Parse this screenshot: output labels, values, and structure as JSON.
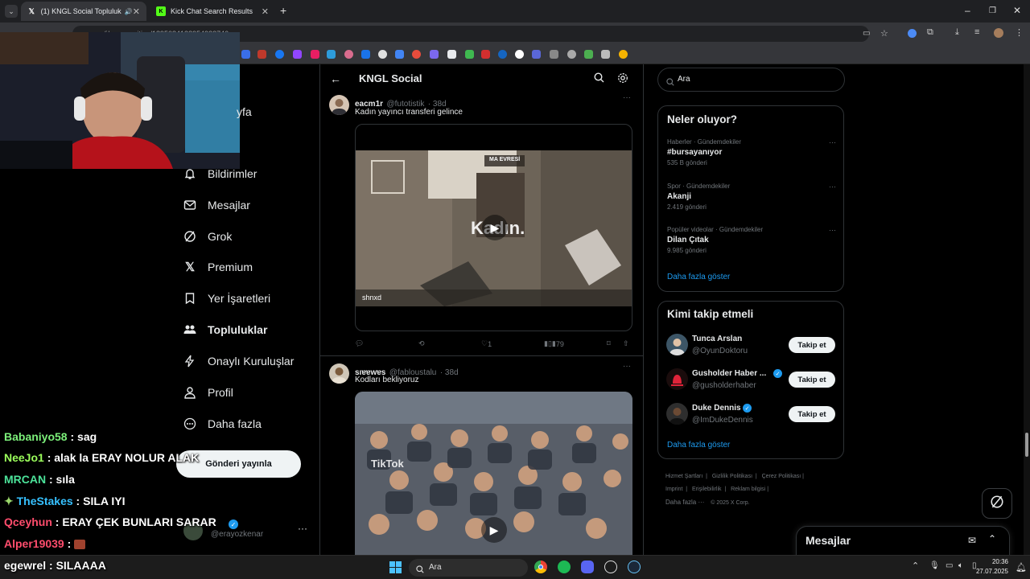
{
  "tabs": [
    {
      "label": "(1) KNGL Social Topluluk / X"
    },
    {
      "label": "Kick Chat Search Results"
    }
  ],
  "address": {
    "url": "x.com/i/communities/1895084139549337...",
    "visible_fragment": "x.com/i/communities/1895084138954933746"
  },
  "nav": {
    "items": [
      {
        "label": "Anasayfa"
      },
      {
        "label": "Bildirimler"
      },
      {
        "label": "Mesajlar"
      },
      {
        "label": "Grok"
      },
      {
        "label": "Premium"
      },
      {
        "label": "Yer İşaretleri"
      },
      {
        "label": "Topluluklar"
      },
      {
        "label": "Onaylı Kuruluşlar"
      },
      {
        "label": "Profil"
      },
      {
        "label": "Daha fazla"
      }
    ],
    "partial_home": "yfa",
    "post_button": "Gönderi yayınla",
    "account_handle": "@erayozkenar"
  },
  "chat": [
    {
      "user": "Babaniyo58",
      "msg": " : sag",
      "color": "#7cf07a"
    },
    {
      "user": "NeeJo1",
      "msg": " : alak la ERAY NOLUR ALAK",
      "color": "#9cff5c"
    },
    {
      "user": "MRCAN",
      "msg": " : sıla",
      "color": "#4ce39a"
    },
    {
      "user": "TheStakes",
      "msg": " : SILA IYI",
      "color": "#36c1ff"
    },
    {
      "user": "Qceyhun",
      "msg": " : ERAY ÇEK BUNLARI SARAR",
      "color": "#ff4d6d"
    },
    {
      "user": "Alper19039",
      "msg": " : ",
      "color": "#ff4d6d"
    },
    {
      "user": "egewrel",
      "msg": " : SILAAAA",
      "color": "#ffffff"
    }
  ],
  "header": {
    "title": "KNGL Social"
  },
  "tweets": [
    {
      "name": "eacm1r",
      "handle": "@futotistik",
      "time": "· 38d",
      "text": "Kadın yayıncı transferi gelince",
      "video_caption": "Kadın.",
      "video_banner": "MA EVRESİ",
      "video_tag": "shnxd",
      "likes": "1",
      "views": "79"
    },
    {
      "name": "sıɐɐwɐs",
      "handle": "@fabloustalu",
      "time": "· 38d",
      "text": "Kodları bekliyoruz",
      "video_watermark": "TikTok"
    }
  ],
  "search": {
    "placeholder": "Ara"
  },
  "trends": {
    "title": "Neler oluyor?",
    "items": [
      {
        "meta": "Haberler · Gündemdekiler",
        "title": "#bursayanıyor",
        "count": "535 B gönderi"
      },
      {
        "meta": "Spor · Gündemdekiler",
        "title": "Akanji",
        "count": "2.419 gönderi"
      },
      {
        "meta": "Popüler videolar · Gündemdekiler",
        "title": "Dilan Çıtak",
        "count": "9.985 gönderi"
      }
    ],
    "more": "Daha fazla göster"
  },
  "who_to_follow": {
    "title": "Kimi takip etmeli",
    "items": [
      {
        "name": "Tunca Arslan",
        "handle": "@OyunDoktoru",
        "button": "Takip et",
        "verified": false
      },
      {
        "name": "Gusholder Haber ...",
        "handle": "@gusholderhaber",
        "button": "Takip et",
        "verified": true
      },
      {
        "name": "Duke Dennis",
        "handle": "@ImDukeDennis",
        "button": "Takip et",
        "verified": true
      }
    ],
    "more": "Daha fazla göster"
  },
  "footer": {
    "links": [
      "Hizmet Şartları",
      "Gizlilik Politikası",
      "Çerez Politikası",
      "Imprint",
      "Erişilebilirlik",
      "Reklam bilgisi",
      "Daha fazla ···",
      "© 2025 X Corp."
    ]
  },
  "messages_dock": {
    "title": "Mesajlar"
  },
  "taskbar": {
    "search": "Ara",
    "time": "20:36",
    "date": "27.07.2025"
  },
  "colors": {
    "accent": "#1d9bf0",
    "background": "#000000",
    "border": "#2f3336"
  }
}
